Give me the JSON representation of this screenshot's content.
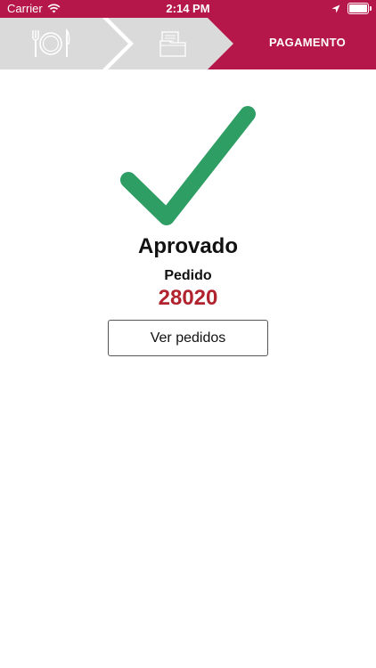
{
  "status_bar": {
    "carrier": "Carrier",
    "time": "2:14 PM",
    "icons": [
      "wifi-icon",
      "location-arrow-icon",
      "battery-icon"
    ]
  },
  "steps": {
    "items": [
      {
        "icon": "plate-cutlery-icon",
        "state": "done"
      },
      {
        "icon": "document-folder-icon",
        "state": "done"
      },
      {
        "label": "PAGAMENTO",
        "state": "active"
      }
    ],
    "colors": {
      "inactive": "#dadada",
      "active": "#b5174a",
      "icon": "#ffffff"
    }
  },
  "result": {
    "icon": "checkmark-icon",
    "icon_color": "#2e9e64",
    "status": "Aprovado",
    "order_label": "Pedido",
    "order_number": "28020",
    "order_number_color": "#b0232f"
  },
  "actions": {
    "view_orders_label": "Ver pedidos"
  }
}
